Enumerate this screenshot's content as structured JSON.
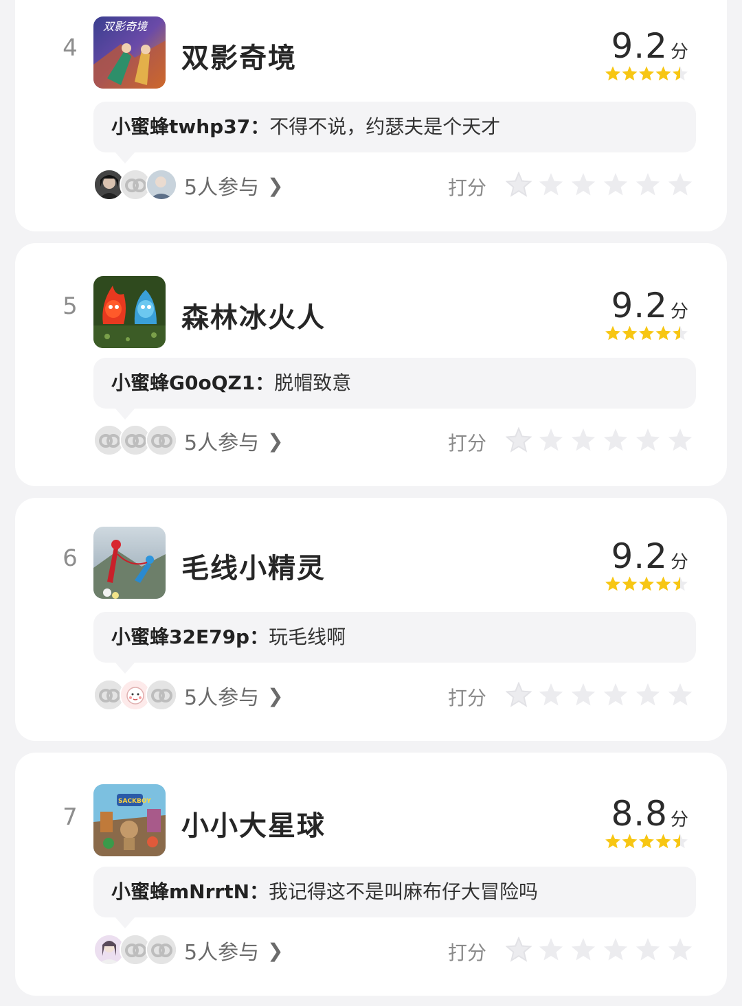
{
  "items": [
    {
      "rank": "4",
      "title": "双影奇境",
      "cover_icon": "split-fiction-cover",
      "cover_text": "双影奇境",
      "score": "9.2",
      "score_unit": "分",
      "stars_value": 4.5,
      "comment_user": "小蜜蜂twhp37：",
      "comment_text": "不得不说，约瑟夫是个天才",
      "participants": "5人参与",
      "rate_label": "打分"
    },
    {
      "rank": "5",
      "title": "森林冰火人",
      "cover_icon": "fireboy-watergirl-cover",
      "score": "9.2",
      "score_unit": "分",
      "stars_value": 4.5,
      "comment_user": "小蜜蜂G0oQZ1：",
      "comment_text": "脱帽致意",
      "participants": "5人参与",
      "rate_label": "打分"
    },
    {
      "rank": "6",
      "title": "毛线小精灵",
      "cover_icon": "unravel-cover",
      "score": "9.2",
      "score_unit": "分",
      "stars_value": 4.5,
      "comment_user": "小蜜蜂32E79p：",
      "comment_text": "玩毛线啊",
      "participants": "5人参与",
      "rate_label": "打分"
    },
    {
      "rank": "7",
      "title": "小小大星球",
      "cover_icon": "sackboy-cover",
      "cover_text": "SACKBOY",
      "score": "8.8",
      "score_unit": "分",
      "stars_value": 4.5,
      "comment_user": "小蜜蜂mNrrtN：",
      "comment_text": "我记得这不是叫麻布仔大冒险吗",
      "participants": "5人参与",
      "rate_label": "打分"
    }
  ],
  "colors": {
    "star_filled": "#f7c613",
    "star_empty": "#ececef",
    "card_bg": "#ffffff",
    "page_bg": "#f3f3f5",
    "bubble_bg": "#f4f4f6"
  }
}
